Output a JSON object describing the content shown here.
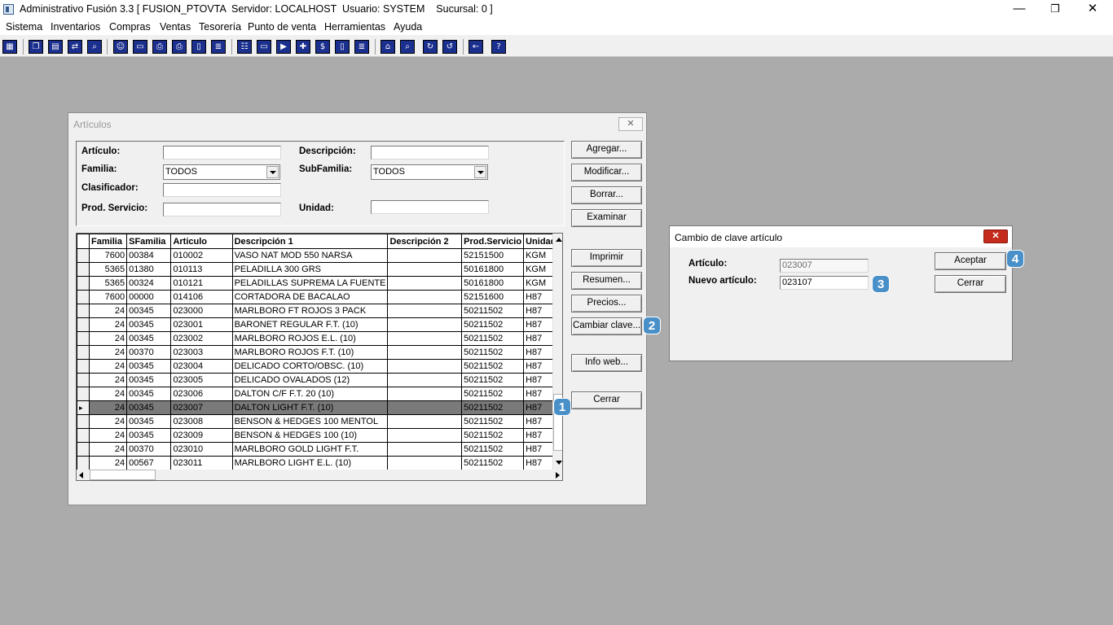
{
  "app": {
    "title": "Administrativo Fusión 3.3 [ FUSION_PTOVTA  Servidor: LOCALHOST  Usuario: SYSTEM    Sucursal: 0 ]",
    "minimize": "—",
    "restore": "❐",
    "close": "✕"
  },
  "menu": [
    "Sistema",
    "Inventarios",
    "Compras",
    "Ventas",
    "Tesorería",
    "Punto de venta",
    "Herramientas",
    "Ayuda"
  ],
  "toolbar_icons": [
    "calculator-icon",
    "copy-icon",
    "clipboard-icon",
    "transfer-icon",
    "zoom-icon",
    "person-icon",
    "folder-icon",
    "printer-out-icon",
    "printer-icon",
    "document-icon",
    "list-icon",
    "users-icon",
    "card-icon",
    "truck-icon",
    "add-icon",
    "dollar-icon",
    "report-icon",
    "table-icon",
    "home-icon",
    "search-icon",
    "refresh-icon",
    "undo-icon",
    "back-icon",
    "help-icon"
  ],
  "articulos_window": {
    "title": "Artículos",
    "close": "✕",
    "labels": {
      "articulo": "Artículo:",
      "descripcion": "Descripción:",
      "familia": "Familia:",
      "subfamilia": "SubFamilia:",
      "clasificador": "Clasificador:",
      "prod_servicio": "Prod. Servicio:",
      "unidad": "Unidad:"
    },
    "values": {
      "articulo": "",
      "descripcion": "",
      "familia": "TODOS",
      "subfamilia": "TODOS",
      "clasificador": "",
      "prod_servicio": "",
      "unidad": ""
    },
    "buttons": {
      "agregar": "Agregar...",
      "modificar": "Modificar...",
      "borrar": "Borrar...",
      "examinar": "Examinar",
      "imprimir": "Imprimir",
      "resumen": "Resumen...",
      "precios": "Precios...",
      "cambiar_clave": "Cambiar clave...",
      "info_web": "Info web...",
      "cerrar": "Cerrar"
    },
    "columns": [
      "Familia",
      "SFamilia",
      "Articulo",
      "Descripción 1",
      "Descripción 2",
      "Prod.Servicio",
      "Unidad"
    ],
    "rows": [
      [
        "7600",
        "00384",
        "010002",
        "VASO NAT MOD 550 NARSA",
        "",
        "52151500",
        "KGM"
      ],
      [
        "5365",
        "01380",
        "010113",
        "PELADILLA 300 GRS",
        "",
        "50161800",
        "KGM"
      ],
      [
        "5365",
        "00324",
        "010121",
        "PELADILLAS SUPREMA LA FUENTE",
        "",
        "50161800",
        "KGM"
      ],
      [
        "7600",
        "00000",
        "014106",
        "CORTADORA DE BACALAO",
        "",
        "52151600",
        "H87"
      ],
      [
        "24",
        "00345",
        "023000",
        "MARLBORO FT ROJOS 3 PACK",
        "",
        "50211502",
        "H87"
      ],
      [
        "24",
        "00345",
        "023001",
        "BARONET REGULAR F.T. (10)",
        "",
        "50211502",
        "H87"
      ],
      [
        "24",
        "00345",
        "023002",
        "MARLBORO ROJOS E.L. (10)",
        "",
        "50211502",
        "H87"
      ],
      [
        "24",
        "00370",
        "023003",
        "MARLBORO ROJOS F.T. (10)",
        "",
        "50211502",
        "H87"
      ],
      [
        "24",
        "00345",
        "023004",
        "DELICADO CORTO/OBSC. (10)",
        "",
        "50211502",
        "H87"
      ],
      [
        "24",
        "00345",
        "023005",
        "DELICADO OVALADOS (12)",
        "",
        "50211502",
        "H87"
      ],
      [
        "24",
        "00345",
        "023006",
        "DALTON C/F F.T. 20 (10)",
        "",
        "50211502",
        "H87"
      ],
      [
        "24",
        "00345",
        "023007",
        "DALTON LIGHT F.T. (10)",
        "",
        "50211502",
        "H87"
      ],
      [
        "24",
        "00345",
        "023008",
        "BENSON & HEDGES 100 MENTOL",
        "",
        "50211502",
        "H87"
      ],
      [
        "24",
        "00345",
        "023009",
        "BENSON & HEDGES 100 (10)",
        "",
        "50211502",
        "H87"
      ],
      [
        "24",
        "00370",
        "023010",
        "MARLBORO GOLD LIGHT F.T.",
        "",
        "50211502",
        "H87"
      ],
      [
        "24",
        "00567",
        "023011",
        "MARLBORO LIGHT E.L. (10)",
        "",
        "50211502",
        "H87"
      ]
    ],
    "selected_row_index": 11,
    "selected_marker": "▸"
  },
  "dialog": {
    "title": "Cambio de clave artículo",
    "close": "✕",
    "articulo_label": "Artículo:",
    "articulo_value": "023007",
    "nuevo_label": "Nuevo artículo:",
    "nuevo_value": "023107",
    "aceptar": "Aceptar",
    "cerrar": "Cerrar"
  },
  "badges": [
    "1",
    "2",
    "3",
    "4"
  ],
  "colors": {
    "badge": "#4a90c8",
    "selected_row": "#7a7a7a",
    "toolbar_icon": "#1b2f8e",
    "desktop": "#ababab"
  }
}
